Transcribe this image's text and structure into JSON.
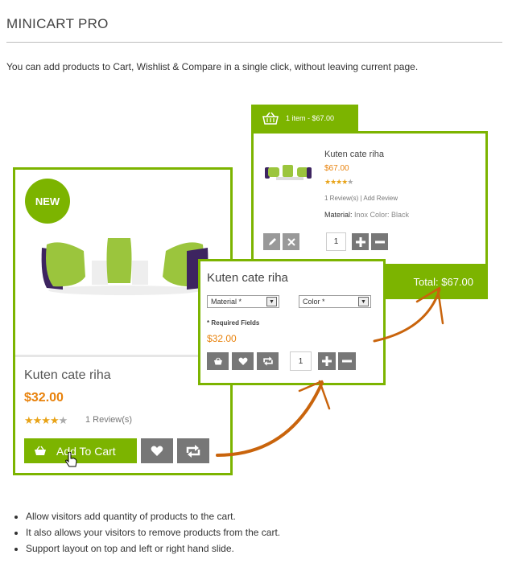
{
  "page": {
    "title": "MINICART PRO",
    "intro": "You can add products to Cart, Wishlist & Compare in a single click, without leaving current page."
  },
  "product_card": {
    "badge": "NEW",
    "name": "Kuten cate riha",
    "price": "$32.00",
    "rating": 4,
    "reviews": "1 Review(s)",
    "add_to_cart_label": "Add To Cart"
  },
  "minicart": {
    "header": "1 item - $67.00",
    "item_name": "Kuten cate riha",
    "item_price": "$67.00",
    "rating": 4,
    "review_link": "1 Review(s)",
    "separator": " | ",
    "add_review": "Add Review",
    "attrs_label": "Material:",
    "attrs_value": "Inox Color: Black",
    "qty": "1",
    "total": "Total: $67.00"
  },
  "quick_view": {
    "name": "Kuten cate riha",
    "material_select": "Material *",
    "color_select": "Color *",
    "required_note": "* Required Fields",
    "price": "$32.00",
    "qty": "1"
  },
  "bullets": [
    "Allow visitors add quantity of products to the cart.",
    "It also allows your visitors to remove products from the cart.",
    "Support layout on top and left or right hand slide."
  ],
  "colors": {
    "green": "#7cb400",
    "orange": "#e8820c",
    "button_gray": "#777777",
    "arrow": "#c9640c"
  }
}
